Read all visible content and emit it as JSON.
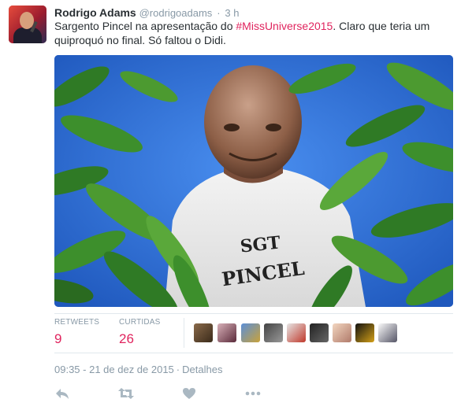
{
  "tweet": {
    "author_name": "Rodrigo Adams",
    "author_handle": "@rodrigoadams",
    "separator": "·",
    "time": "3 h",
    "text_before": "Sargento Pincel na apresentação do ",
    "hashtag": "#MissUniverse2015",
    "text_after": ". Claro que teria um quiproquó no final. Só faltou o Didi.",
    "shirt_line1": "SGT",
    "shirt_line2": "PINCEL"
  },
  "stats": {
    "retweets_label": "RETWEETS",
    "retweets_value": "9",
    "likes_label": "CURTIDAS",
    "likes_value": "26"
  },
  "footer": {
    "date": "09:35 - 21 de dez de 2015",
    "separator": "·",
    "details_label": "Detalhes"
  },
  "colors": {
    "accent": "#e0245e",
    "muted": "#8899a6",
    "text": "#292f33",
    "divider": "#e1e8ed"
  },
  "icons": {
    "reply": "reply-icon",
    "retweet": "retweet-icon",
    "like": "heart-icon",
    "more": "more-dots-icon"
  }
}
